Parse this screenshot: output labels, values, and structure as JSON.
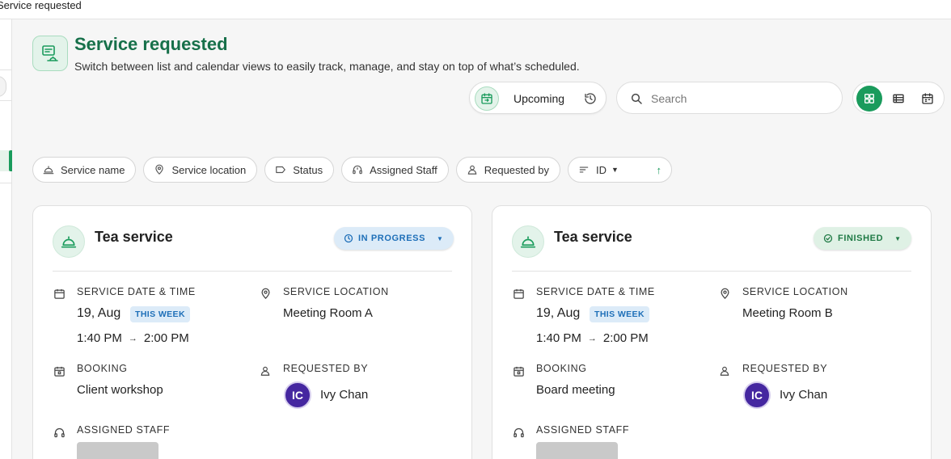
{
  "window": {
    "title": "Service requested"
  },
  "header": {
    "title": "Service requested",
    "subtitle": "Switch between list and calendar views to easily track, manage, and stay on top of what’s scheduled.",
    "icon": "service-request-icon"
  },
  "toolbar": {
    "period_label": "Upcoming",
    "search_placeholder": "Search",
    "views": [
      "grid-view-icon",
      "list-view-icon",
      "calendar-view-icon"
    ],
    "active_view": "grid"
  },
  "filters": {
    "items": [
      {
        "label": "Service name",
        "icon": "service-bell-icon"
      },
      {
        "label": "Service location",
        "icon": "location-pin-icon"
      },
      {
        "label": "Status",
        "icon": "tag-icon"
      },
      {
        "label": "Assigned Staff",
        "icon": "headset-icon"
      },
      {
        "label": "Requested by",
        "icon": "person-icon"
      }
    ],
    "sort": {
      "label": "ID",
      "direction": "ascending"
    }
  },
  "labels": {
    "service_date_time": "SERVICE DATE & TIME",
    "service_location": "SERVICE LOCATION",
    "booking": "BOOKING",
    "requested_by": "REQUESTED BY",
    "assigned_staff": "ASSIGNED STAFF"
  },
  "cards": [
    {
      "service_name": "Tea service",
      "status": "IN PROGRESS",
      "date": "19, Aug",
      "week_badge": "THIS WEEK",
      "start_time": "1:40 PM",
      "end_time": "2:00 PM",
      "location": "Meeting Room A",
      "booking": "Client workshop",
      "requester_initials": "IC",
      "requester_name": "Ivy Chan"
    },
    {
      "service_name": "Tea service",
      "status": "FINISHED",
      "date": "19, Aug",
      "week_badge": "THIS WEEK",
      "start_time": "1:40 PM",
      "end_time": "2:00 PM",
      "location": "Meeting Room B",
      "booking": "Board meeting",
      "requester_initials": "IC",
      "requester_name": "Ivy Chan"
    }
  ],
  "colors": {
    "accent": "#1a9b5c",
    "title": "#17704a",
    "in_progress": "#1e6fb8",
    "finished": "#1f7a45",
    "avatar": "#4527a0"
  }
}
